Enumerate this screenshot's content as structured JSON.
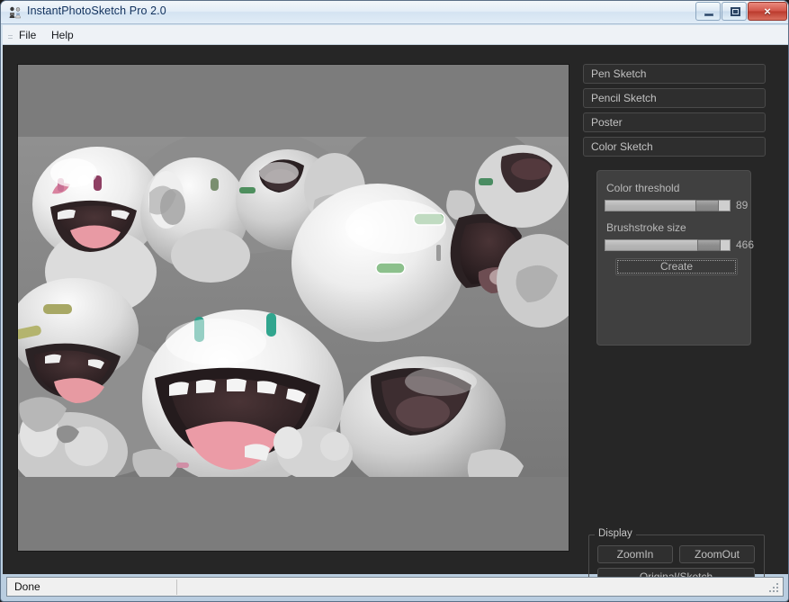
{
  "window": {
    "title": "InstantPhotoSketch Pro 2.0",
    "icon": "app-people-icon",
    "controls": {
      "minimize": "minimize",
      "maximize": "restore",
      "close": "×"
    },
    "accent_close": "#c2412f",
    "titlebar_text_color": "#10305c"
  },
  "menubar": {
    "items": [
      {
        "label": "File"
      },
      {
        "label": "Help"
      }
    ]
  },
  "canvas": {
    "background_color": "#7c7c7c",
    "image_alt": "posterized grayscale photo of white cartoon toy figurines with open mouths"
  },
  "side_panel": {
    "modes": [
      {
        "label": "Pen Sketch",
        "selected": false
      },
      {
        "label": "Pencil Sketch",
        "selected": false
      },
      {
        "label": "Poster",
        "selected": false
      },
      {
        "label": "Color Sketch",
        "selected": true
      }
    ],
    "settings": {
      "threshold": {
        "label": "Color threshold",
        "value": "89",
        "fill_percent": 80
      },
      "brushstroke": {
        "label": "Brushstroke size",
        "value": "466",
        "fill_percent": 81
      },
      "create_label": "Create"
    },
    "display": {
      "legend": "Display",
      "zoom_in": "ZoomIn",
      "zoom_out": "ZoomOut",
      "original_sketch": "Original/Sketch"
    }
  },
  "statusbar": {
    "message": "Done"
  }
}
